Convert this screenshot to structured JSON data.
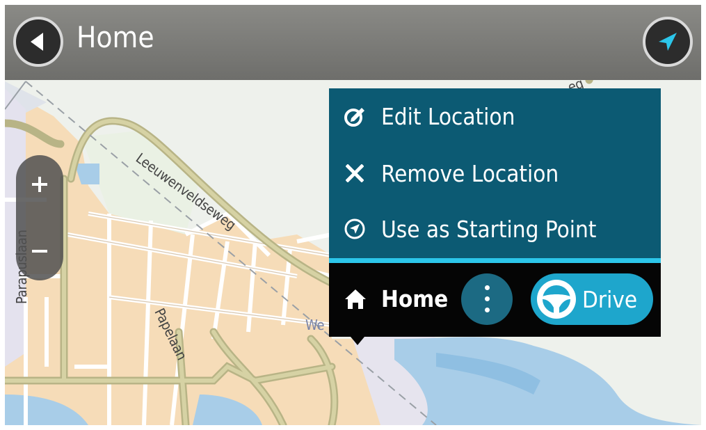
{
  "header": {
    "title": "Home",
    "back_icon": "back-arrow-icon",
    "nav_icon": "navigation-arrow-icon"
  },
  "zoom": {
    "zoom_in_label": "+",
    "zoom_out_label": "−"
  },
  "map": {
    "street_labels": [
      "Leeuwenveldseweg",
      "Papelaan",
      "Parapuslaan",
      "We",
      "eg"
    ]
  },
  "popup": {
    "menu_items": [
      {
        "label": "Edit Location",
        "icon": "edit-location-icon"
      },
      {
        "label": "Remove Location",
        "icon": "close-icon"
      },
      {
        "label": "Use as Starting Point",
        "icon": "starting-point-icon"
      }
    ],
    "location_name": "Home",
    "location_icon": "home-icon",
    "more_icon": "more-vertical-icon",
    "drive_label": "Drive",
    "drive_icon": "steering-wheel-icon"
  },
  "colors": {
    "menu_bg": "#0c5a73",
    "accent": "#2cc6ea",
    "drive_button": "#1ea6cc",
    "panel_bg": "#050505",
    "header_bg": "#7c7c79"
  }
}
